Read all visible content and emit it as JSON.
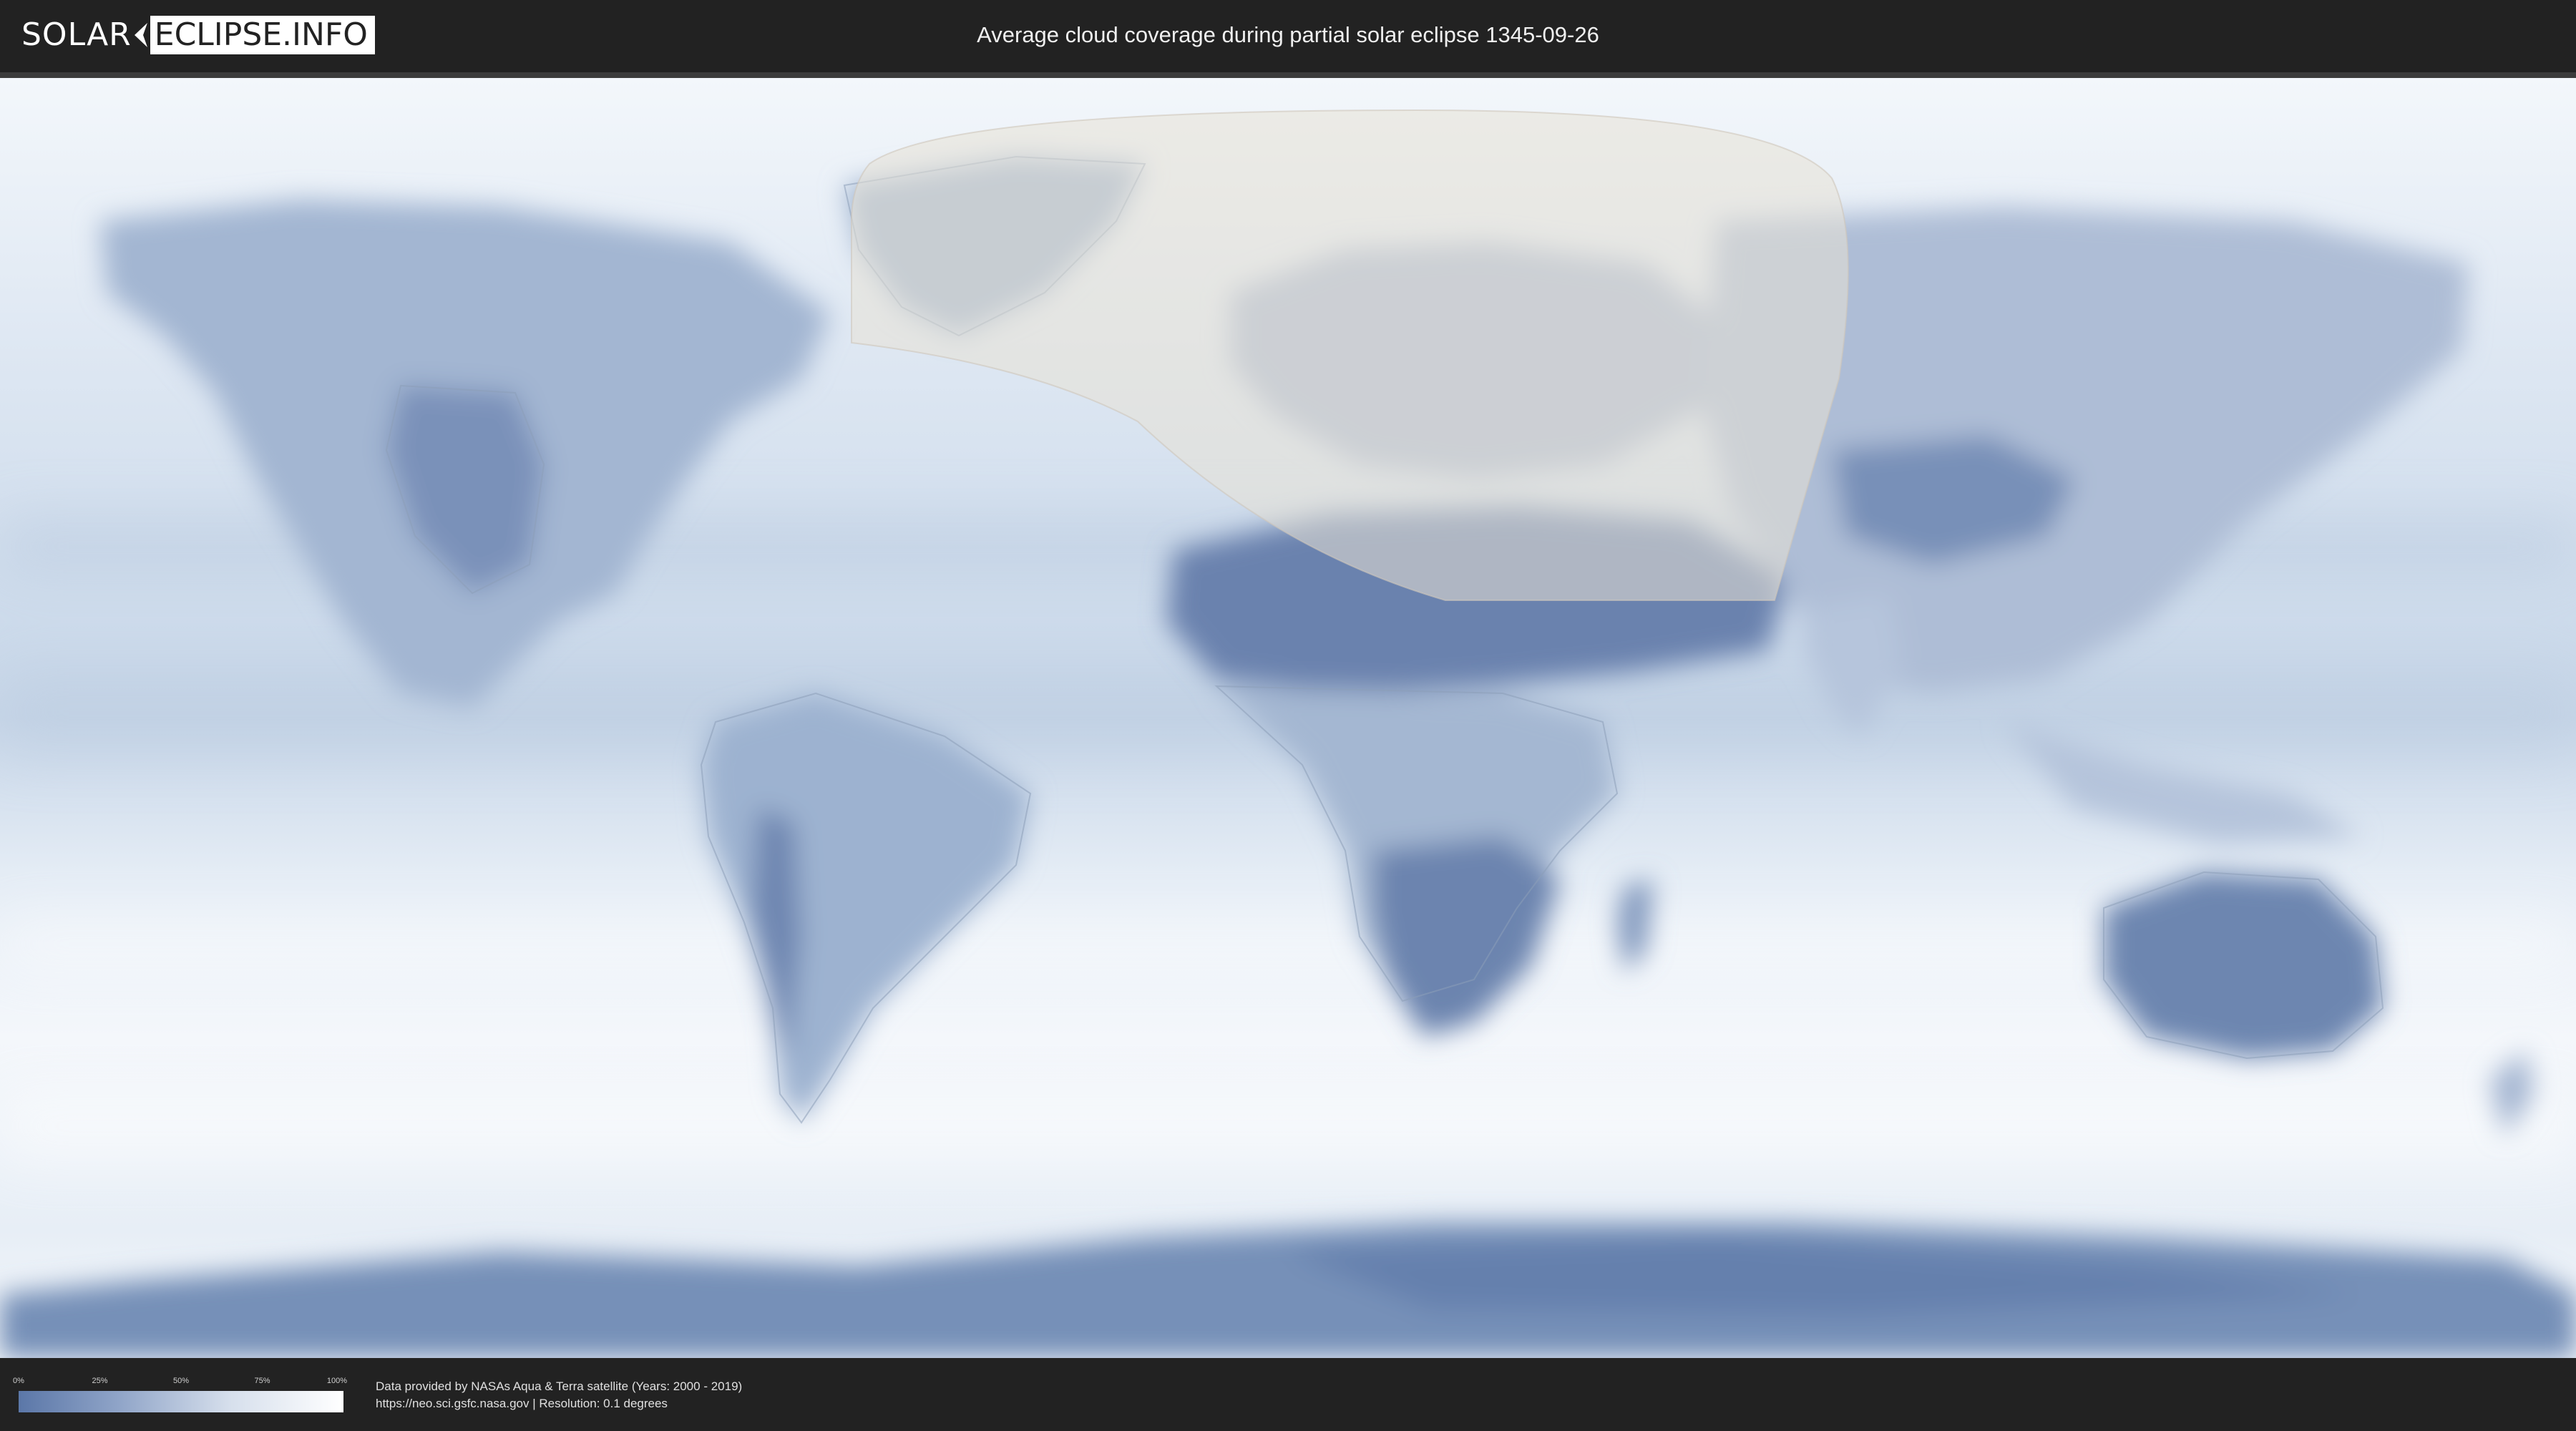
{
  "header": {
    "logo_left": "SOLAR",
    "logo_right": "ECLIPSE.INFO",
    "title": "Average cloud coverage during partial solar eclipse 1345-09-26"
  },
  "map": {
    "projection": "equirectangular world",
    "layer": "average cloud coverage",
    "eclipse_visibility_overlay_color": "#e8e1d6",
    "ocean_tint": "#e6eef7",
    "land_dark_tint": "#6f87b0"
  },
  "legend": {
    "ticks": [
      "0%",
      "25%",
      "50%",
      "75%",
      "100%"
    ],
    "gradient_from": "#5b77a8",
    "gradient_to": "#ffffff"
  },
  "credits": {
    "line1": "Data provided by NASAs Aqua & Terra satellite (Years: 2000 - 2019)",
    "line2": "https://neo.sci.gsfc.nasa.gov | Resolution: 0.1 degrees"
  }
}
